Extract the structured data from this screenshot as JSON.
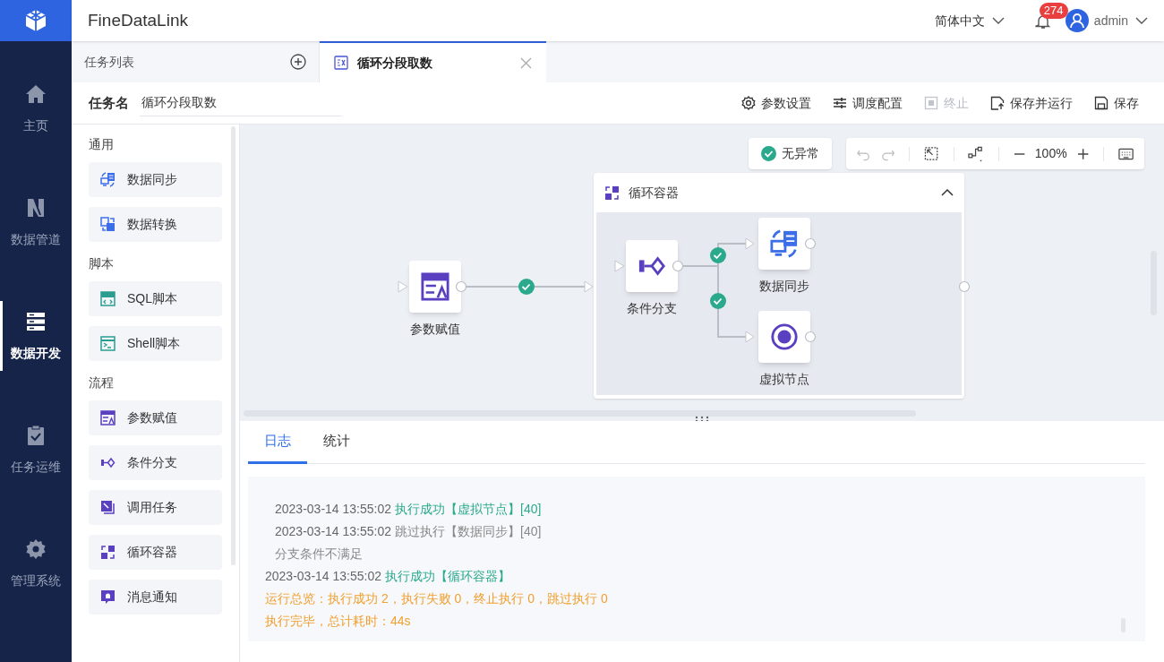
{
  "app": {
    "name": "FineDataLink"
  },
  "header": {
    "language": "简体中文",
    "notifications": "274",
    "user": "admin"
  },
  "nav": [
    {
      "label": "主页",
      "kind": "home",
      "selected": false
    },
    {
      "label": "数据管道",
      "kind": "pipeline",
      "selected": false
    },
    {
      "label": "数据开发",
      "kind": "dev",
      "selected": true
    },
    {
      "label": "任务运维",
      "kind": "ops",
      "selected": false
    },
    {
      "label": "管理系统",
      "kind": "admin",
      "selected": false
    }
  ],
  "tabs": [
    {
      "label": "任务列表",
      "kind": "list",
      "selected": false
    },
    {
      "label": "循环分段取数",
      "kind": "task",
      "selected": true
    }
  ],
  "task": {
    "label": "任务名",
    "value": "循环分段取数"
  },
  "actions": [
    {
      "label": "参数设置",
      "kind": "settings",
      "disabled": false
    },
    {
      "label": "调度配置",
      "kind": "schedule",
      "disabled": false
    },
    {
      "label": "终止",
      "kind": "stop",
      "disabled": true
    },
    {
      "label": "保存并运行",
      "kind": "run",
      "disabled": false
    },
    {
      "label": "保存",
      "kind": "save",
      "disabled": false
    }
  ],
  "palette": [
    {
      "title": "通用",
      "items": [
        {
          "label": "数据同步",
          "kind": "sync"
        },
        {
          "label": "数据转换",
          "kind": "transform"
        }
      ]
    },
    {
      "title": "脚本",
      "items": [
        {
          "label": "SQL脚本",
          "kind": "sql"
        },
        {
          "label": "Shell脚本",
          "kind": "shell"
        }
      ]
    },
    {
      "title": "流程",
      "items": [
        {
          "label": "参数赋值",
          "kind": "param"
        },
        {
          "label": "条件分支",
          "kind": "branch"
        },
        {
          "label": "调用任务",
          "kind": "invoke"
        },
        {
          "label": "循环容器",
          "kind": "loop"
        },
        {
          "label": "消息通知",
          "kind": "notify"
        }
      ]
    }
  ],
  "canvas": {
    "status": "无异常",
    "zoom": "100%",
    "nodes": [
      {
        "label": "参数赋值",
        "kind": "param"
      }
    ],
    "container": {
      "title": "循环容器",
      "expanded": true,
      "nodes": [
        {
          "label": "条件分支",
          "kind": "branch"
        },
        {
          "label": "数据同步",
          "kind": "sync"
        },
        {
          "label": "虚拟节点",
          "kind": "virtual"
        }
      ]
    },
    "edges": [
      {
        "succeeded": true
      },
      {
        "succeeded": true
      },
      {
        "succeeded": true
      }
    ]
  },
  "log": {
    "tabs": [
      {
        "label": "日志",
        "selected": true
      },
      {
        "label": "统计",
        "selected": false
      }
    ],
    "lines": [
      {
        "time": "2023-03-14 13:55:02",
        "message": "执行成功【虚拟节点】[40]",
        "kind": "success",
        "nested": true
      },
      {
        "time": "2023-03-14 13:55:02",
        "message": "跳过执行【数据同步】[40]",
        "kind": "skipped",
        "nested": true
      },
      {
        "message": "分支条件不满足",
        "kind": "note",
        "nested": true
      },
      {
        "time": "2023-03-14 13:55:02",
        "message": "执行成功【循环容器】",
        "kind": "success",
        "nested": false
      },
      {
        "message": "运行总览：执行成功 2，执行失败 0，终止执行 0，跳过执行 0",
        "kind": "summary",
        "nested": false
      },
      {
        "message": "执行完毕，总计耗时：44s",
        "kind": "summary",
        "nested": false
      }
    ]
  }
}
